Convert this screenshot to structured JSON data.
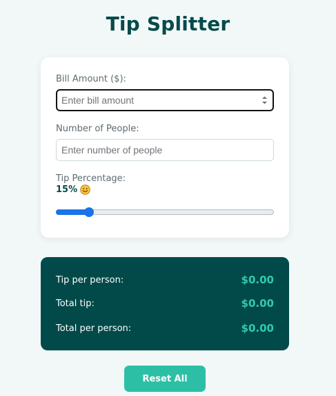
{
  "title": "Tip Splitter",
  "bill": {
    "label": "Bill Amount ($):",
    "placeholder": "Enter bill amount",
    "value": ""
  },
  "people": {
    "label": "Number of People:",
    "placeholder": "Enter number of people",
    "value": ""
  },
  "tip": {
    "label": "Tip Percentage:",
    "value_text": "15%",
    "emoji_icon": "slightly-smiling-face-icon",
    "percent": 15,
    "min": 0,
    "max": 100
  },
  "results": {
    "tip_per_person_label": "Tip per person:",
    "tip_per_person_value": "$0.00",
    "total_tip_label": "Total tip:",
    "total_tip_value": "$0.00",
    "total_per_person_label": "Total per person:",
    "total_per_person_value": "$0.00"
  },
  "reset_label": "Reset All",
  "colors": {
    "title": "#074a4a",
    "results_bg": "#024a4a",
    "accent": "#2dbfa6",
    "result_value": "#33c9ad",
    "slider": "#1a73e8",
    "page_bg": "#f2f8f8"
  }
}
